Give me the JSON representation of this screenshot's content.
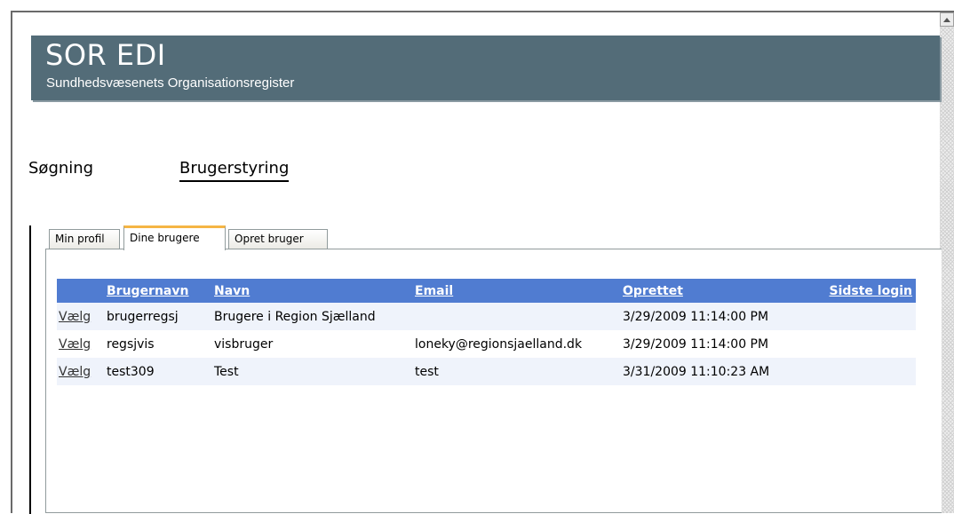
{
  "header": {
    "title": "SOR EDI",
    "subtitle": "Sundhedsvæsenets Organisationsregister"
  },
  "nav": {
    "search": "Søgning",
    "user_admin": "Brugerstyring"
  },
  "tabs": [
    {
      "label": "Min profil",
      "selected": false
    },
    {
      "label": "Dine brugere",
      "selected": true
    },
    {
      "label": "Opret bruger",
      "selected": false
    }
  ],
  "table": {
    "columns": [
      "",
      "Brugernavn",
      "Navn",
      "Email",
      "Oprettet",
      "Sidste login"
    ],
    "rows": [
      {
        "select": "Vælg",
        "username": "brugerregsj",
        "name": "Brugere i Region Sjælland",
        "email": "",
        "created": "3/29/2009 11:14:00 PM",
        "last_login": ""
      },
      {
        "select": "Vælg",
        "username": "regsjvis",
        "name": "visbruger",
        "email": "loneky@regionsjaelland.dk",
        "created": "3/29/2009 11:14:00 PM",
        "last_login": ""
      },
      {
        "select": "Vælg",
        "username": "test309",
        "name": "Test",
        "email": "test",
        "created": "3/31/2009 11:10:23 AM",
        "last_login": ""
      }
    ]
  },
  "colors": {
    "banner": "#536c78",
    "table_header": "#507cd1",
    "row_alt": "#eff3fb",
    "tab_active_accent": "#f5b544"
  },
  "icons": {
    "scroll_up": "scroll-up-arrow-icon"
  }
}
